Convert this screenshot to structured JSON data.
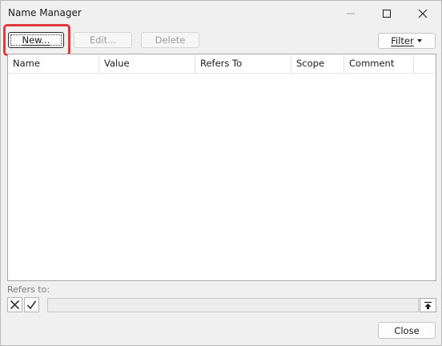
{
  "window": {
    "title": "Name Manager"
  },
  "toolbar": {
    "new_label": "New...",
    "edit_label": "Edit...",
    "delete_label": "Delete",
    "filter_label": "Filter"
  },
  "table": {
    "columns": [
      "Name",
      "Value",
      "Refers To",
      "Scope",
      "Comment"
    ],
    "rows": []
  },
  "refers_to": {
    "label": "Refers to:",
    "value": ""
  },
  "footer": {
    "close_label": "Close"
  },
  "colors": {
    "highlight": "#e0393e",
    "window_bg": "#f0f0f0",
    "list_bg": "#ffffff"
  }
}
